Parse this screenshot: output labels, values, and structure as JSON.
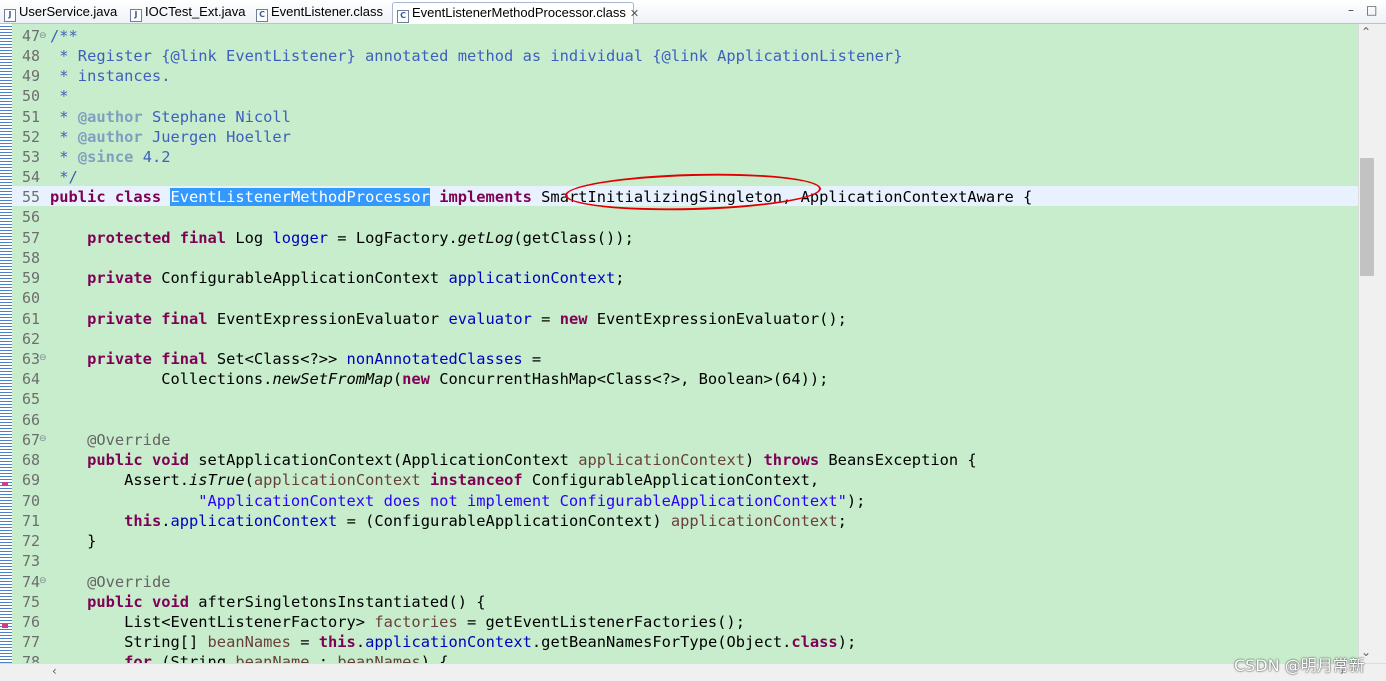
{
  "tabs": [
    {
      "label": "UserService.java",
      "icon": "java-file-icon"
    },
    {
      "label": "IOCTest_Ext.java",
      "icon": "java-file-icon"
    },
    {
      "label": "EventListener.class",
      "icon": "class-file-icon"
    },
    {
      "label": "EventListenerMethodProcessor.class",
      "icon": "class-file-icon",
      "active": true
    }
  ],
  "window_controls": {
    "minimize": "–",
    "maximize": "□"
  },
  "editor": {
    "first_line": 47,
    "selected_word": "EventListenerMethodProcessor",
    "circled_word": "SmartInitializingSingleton",
    "lines": [
      "47",
      "48",
      "49",
      "50",
      "51",
      "52",
      "53",
      "54",
      "55",
      "56",
      "57",
      "58",
      "59",
      "60",
      "61",
      "62",
      "63",
      "64",
      "65",
      "66",
      "67",
      "68",
      "69",
      "70",
      "71",
      "72",
      "73",
      "74",
      "75",
      "76",
      "77",
      "78"
    ]
  },
  "watermark": "CSDN @明月常新",
  "colors": {
    "editor_bg": "#c7edcc",
    "keyword": "#7f0055",
    "comment": "#3f5fbf",
    "field": "#0000c0",
    "string": "#2a00ff",
    "selection": "#3399ff",
    "annotation_circle": "#e00000"
  }
}
